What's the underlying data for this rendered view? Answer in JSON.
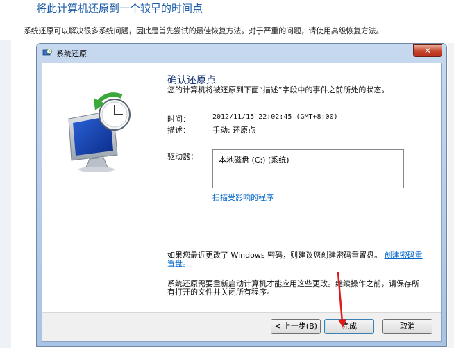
{
  "page": {
    "title": "将此计算机还原到一个较早的时间点",
    "description": "系统还原可以解决很多系统问题，因此是首先尝试的最佳恢复方法。对于严重的问题，请使用高级恢复方法。"
  },
  "window": {
    "title": "系统还原",
    "close_label": "✕",
    "heading": "确认还原点",
    "intro": "您的计算机将被还原到下面“描述”字段中的事件之前所处的状态。",
    "time_label": "时间：",
    "time_value": "2012/11/15 22:02:45 (GMT+8:00)",
    "desc_label": "描述：",
    "desc_value": "手动: 还原点",
    "drives_label": "驱动器：",
    "drive_item": "本地磁盘 (C:) (系统)",
    "scan_link": "扫描受影响的程序",
    "password_note": "如果您最近更改了 Windows 密码，则建议您创建密码重置盘。",
    "password_link": "创建密码重置盘。",
    "restart_note": "系统还原需要重新启动计算机才能应用这些更改。继续操作之前，请保存所有打开的文件并关闭所有程序。",
    "buttons": {
      "back": "< 上一步(B)",
      "finish": "完成",
      "cancel": "取消"
    }
  },
  "colors": {
    "annotation_arrow": "#e01a1a",
    "link": "#0066cc"
  }
}
